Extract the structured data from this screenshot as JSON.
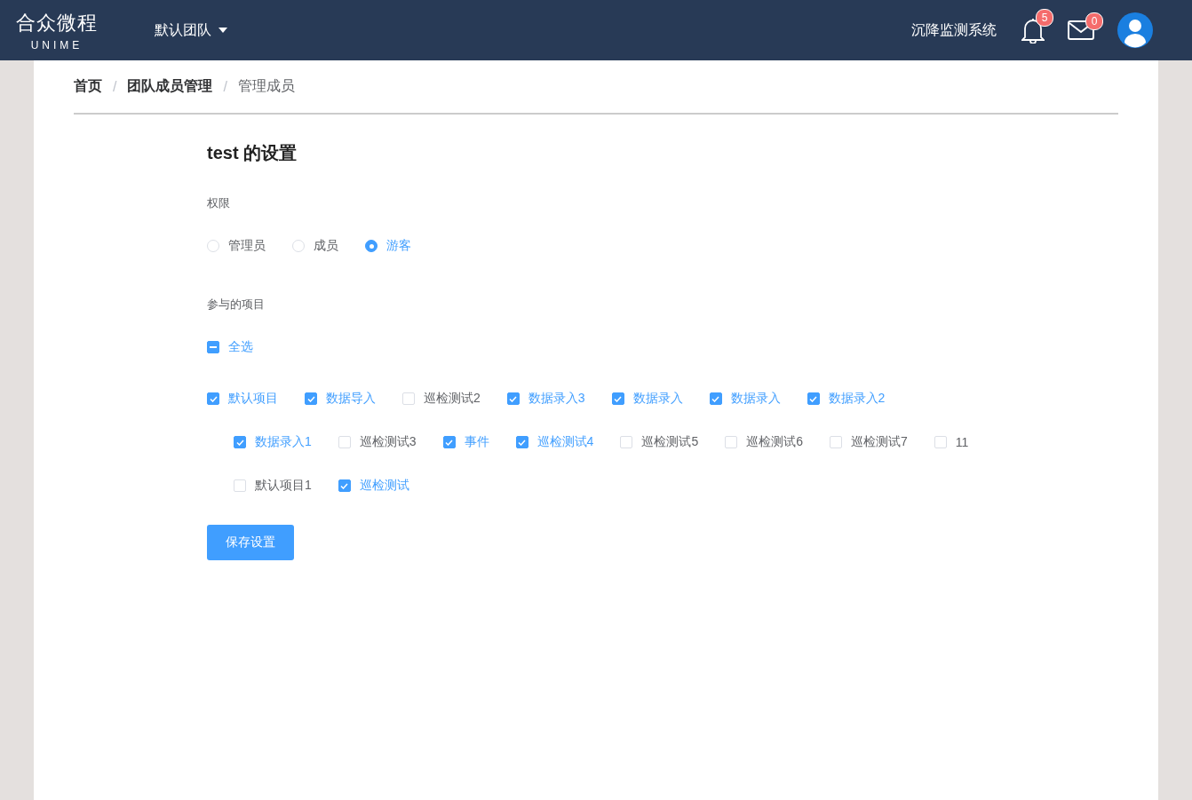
{
  "header": {
    "logo": {
      "title": "合众微程",
      "subtitle": "UNIME"
    },
    "team_menu": {
      "label": "默认团队"
    },
    "system_name": "沉降监测系统",
    "notifications": {
      "count": "5"
    },
    "messages": {
      "count": "0"
    }
  },
  "breadcrumb": [
    {
      "label": "首页",
      "current": false
    },
    {
      "label": "团队成员管理",
      "current": false
    },
    {
      "label": "管理成员",
      "current": true
    }
  ],
  "separator": "/",
  "title": "test 的设置",
  "permission": {
    "label": "权限",
    "options": [
      {
        "label": "管理员",
        "selected": false
      },
      {
        "label": "成员",
        "selected": false
      },
      {
        "label": "游客",
        "selected": true
      }
    ]
  },
  "projects": {
    "label": "参与的项目",
    "select_all": {
      "label": "全选",
      "indeterminate": true
    },
    "rows": [
      [
        {
          "label": "默认项目",
          "checked": true
        },
        {
          "label": "数据导入",
          "checked": true
        },
        {
          "label": "巡检测试2",
          "checked": false
        },
        {
          "label": "数据录入3",
          "checked": true
        },
        {
          "label": "数据录入",
          "checked": true
        },
        {
          "label": "数据录入",
          "checked": true
        },
        {
          "label": "数据录入2",
          "checked": true
        }
      ],
      [
        {
          "label": "数据录入1",
          "checked": true
        },
        {
          "label": "巡检测试3",
          "checked": false
        },
        {
          "label": "事件",
          "checked": true
        },
        {
          "label": "巡检测试4",
          "checked": true
        },
        {
          "label": "巡检测试5",
          "checked": false
        },
        {
          "label": "巡检测试6",
          "checked": false
        },
        {
          "label": "巡检测试7",
          "checked": false
        },
        {
          "label": "11",
          "checked": false
        }
      ],
      [
        {
          "label": "默认项目1",
          "checked": false
        },
        {
          "label": "巡检测试",
          "checked": true
        }
      ]
    ]
  },
  "save_button": "保存设置"
}
